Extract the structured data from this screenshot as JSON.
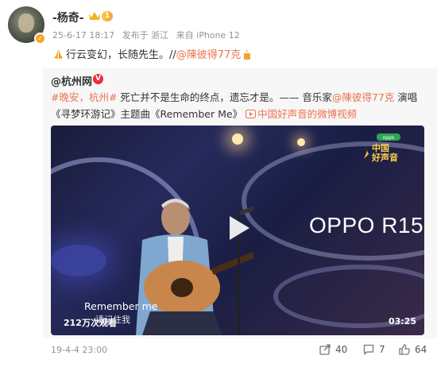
{
  "author": {
    "name": "-杨奇-",
    "level": "1",
    "avatar_badge": "✓"
  },
  "meta": {
    "time": "25-6-17 18:17",
    "source": "发布于 浙江",
    "device": "来自 iPhone 12"
  },
  "post": {
    "text_main": "行云变幻，长随先生。//",
    "mention": "@陳彼得77克"
  },
  "repost_card": {
    "source_author": "@杭州网",
    "verified_badge": "V",
    "hashtag1": "#晚安，杭州#",
    "body": " 死亡并不是生命的终点，遗忘才是。—— 音乐家",
    "mention": "@陳彼得77克",
    "body_end": " 演唱《寻梦环游记》主题曲《Remember Me》",
    "video_link": "中国好声音的微博视频",
    "video": {
      "brand_text": "OPPO R15",
      "show_logo_line1": "中国",
      "show_logo_line2": "好声音",
      "subtitle_en": "Remember me",
      "subtitle_cn": "请记住我",
      "views": "212万次观看",
      "duration": "03:25"
    }
  },
  "footer": {
    "time": "19-4-4 23:00",
    "reposts": "40",
    "comments": "7",
    "likes": "64"
  },
  "colors": {
    "accent": "#eb7350",
    "meta_gray": "#939393",
    "card_bg": "#f7f7f7"
  }
}
